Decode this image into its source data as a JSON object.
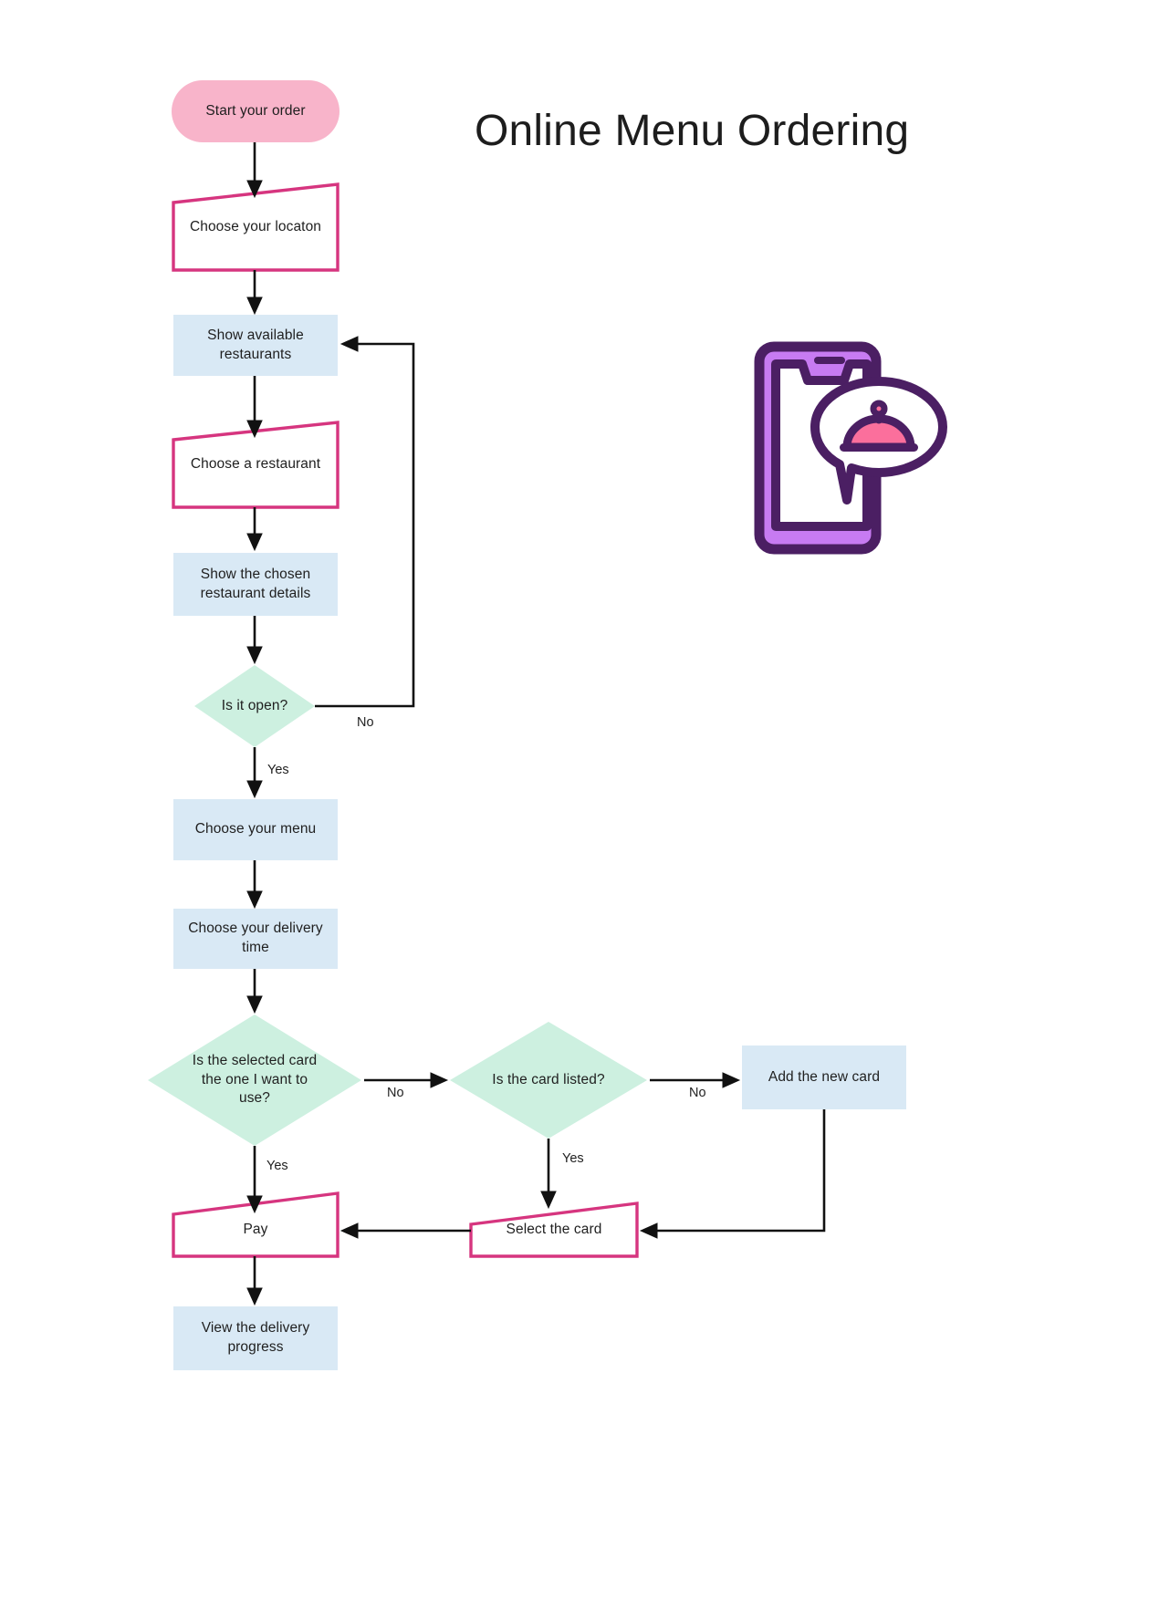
{
  "title": "Online Menu Ordering",
  "illustration": {
    "name": "smartphone-food-order-icon",
    "colors": {
      "outline": "#4b1f63",
      "screen_frame": "#c07af0",
      "dish": "#fb6f9c"
    }
  },
  "palette": {
    "terminator_fill": "#f8b4ca",
    "process_fill": "#d9e9f5",
    "decision_fill": "#cdf0e0",
    "manual_stroke": "#d6357f",
    "arrow": "#111111",
    "text": "#1f1f1f"
  },
  "nodes": [
    {
      "id": "start",
      "type": "terminator",
      "label": "Start your order"
    },
    {
      "id": "location",
      "type": "manual",
      "label": "Choose your locaton"
    },
    {
      "id": "show_rest",
      "type": "process",
      "label": "Show available restaurants"
    },
    {
      "id": "choose_rest",
      "type": "manual",
      "label": "Choose a restaurant"
    },
    {
      "id": "show_detail",
      "type": "process",
      "label": "Show the chosen restaurant details"
    },
    {
      "id": "is_open",
      "type": "decision",
      "label": "Is it open?"
    },
    {
      "id": "choose_menu",
      "type": "process",
      "label": "Choose your menu"
    },
    {
      "id": "delivery_time",
      "type": "process",
      "label": "Choose your delivery time"
    },
    {
      "id": "card_check",
      "type": "decision",
      "label": "Is the selected card the one I want to use?"
    },
    {
      "id": "card_listed",
      "type": "decision",
      "label": "Is the card listed?"
    },
    {
      "id": "add_card",
      "type": "process",
      "label": "Add the new card"
    },
    {
      "id": "select_card",
      "type": "manual",
      "label": "Select the card"
    },
    {
      "id": "pay",
      "type": "manual",
      "label": "Pay"
    },
    {
      "id": "view_progress",
      "type": "process",
      "label": "View the delivery progress"
    }
  ],
  "edge_labels": {
    "is_open_no": "No",
    "is_open_yes": "Yes",
    "card_check_no": "No",
    "card_check_yes": "Yes",
    "card_listed_no": "No",
    "card_listed_yes": "Yes"
  }
}
